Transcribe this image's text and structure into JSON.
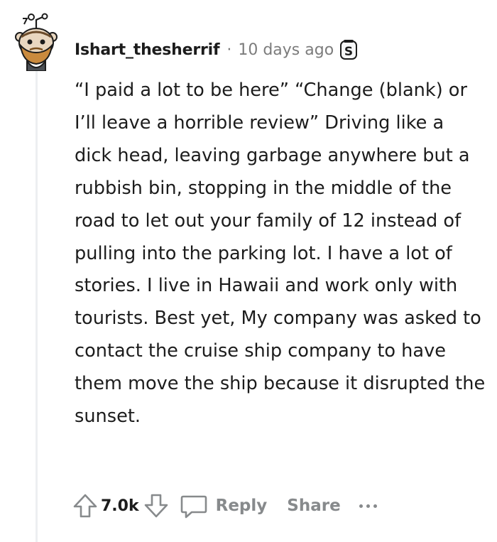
{
  "comment": {
    "author": "Ishart_thesherrif",
    "separator": "·",
    "timestamp": "10 days ago",
    "award_glyph": "S",
    "avatar_icon": "snoo-avatar-icon",
    "body": "“I paid a lot to be here” “Change (blank) or I’ll leave a horrible review” Driving like a dick head, leaving garbage anywhere but a rubbish bin, stopping in the middle of the road to let out your family of 12 instead of pulling into the parking lot. I have a lot of stories. I live in Hawaii and work only with tourists. Best yet, My company was asked to contact the cruise ship company to have them move the ship because it disrupted the sunset."
  },
  "actions": {
    "score": "7.0k",
    "reply_label": "Reply",
    "share_label": "Share",
    "upvote_icon": "upvote-arrow-icon",
    "downvote_icon": "downvote-arrow-icon",
    "reply_icon": "speech-bubble-icon",
    "more_icon": "more-dots-icon"
  },
  "colors": {
    "text": "#1c1c1c",
    "meta": "#7c7c7c",
    "action": "#878a8c",
    "thread_line": "#edeff1"
  }
}
